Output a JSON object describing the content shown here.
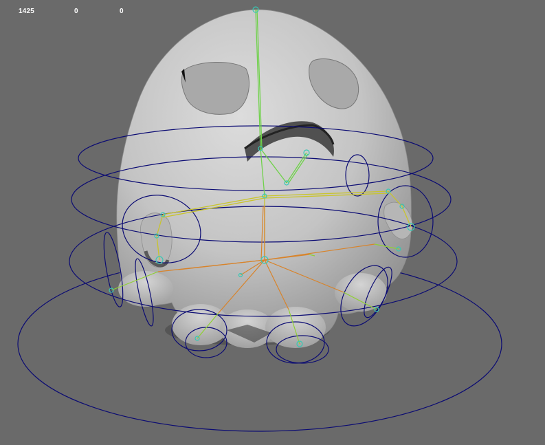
{
  "viewport": {
    "hud_values": [
      "1425",
      "0",
      "0"
    ],
    "background": "#6a6a6a"
  },
  "model": {
    "mesh_color": "#c8c8c8",
    "control_curve_color": "#0b0b73",
    "bone_colors": {
      "spine": "#6fd14a",
      "arms": "#c9c42c",
      "skirt": "#d8832a",
      "joint": "#36c8b4"
    }
  }
}
